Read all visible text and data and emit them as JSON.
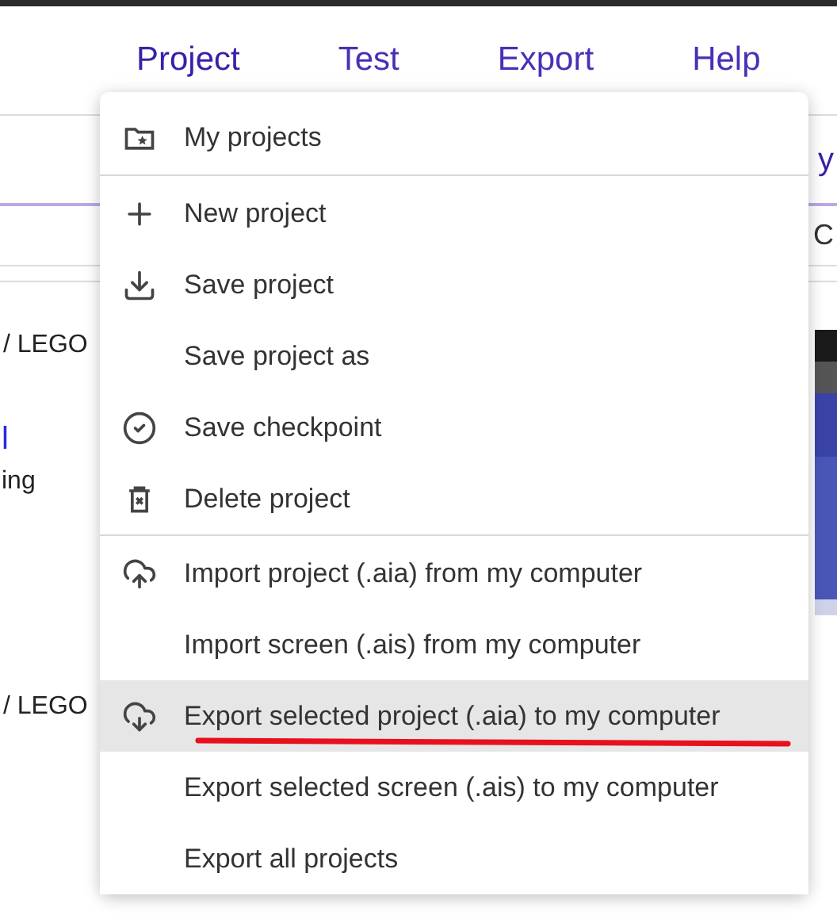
{
  "menubar": {
    "items": [
      {
        "label": "Project",
        "selected": true
      },
      {
        "label": "Test",
        "selected": false
      },
      {
        "label": "Export",
        "selected": false
      },
      {
        "label": "Help",
        "selected": false
      }
    ]
  },
  "background": {
    "texts": [
      "/ LEGO",
      "l",
      "ing",
      "/ LEGO"
    ],
    "right_texts": [
      "y",
      "C"
    ]
  },
  "menu": {
    "groups": [
      {
        "items": [
          {
            "label": "My projects",
            "selected": false,
            "underlined": false
          }
        ]
      },
      {
        "items": [
          {
            "label": "New project",
            "selected": false,
            "underlined": false
          },
          {
            "label": "Save project",
            "selected": false,
            "underlined": false
          },
          {
            "label": "Save project as",
            "selected": false,
            "underlined": false
          },
          {
            "label": "Save checkpoint",
            "selected": false,
            "underlined": false
          },
          {
            "label": "Delete project",
            "selected": false,
            "underlined": false
          }
        ]
      },
      {
        "items": [
          {
            "label": "Import project (.aia) from my computer",
            "selected": false,
            "underlined": false
          },
          {
            "label": "Import screen (.ais) from my computer",
            "selected": false,
            "underlined": false
          },
          {
            "label": "Export selected project (.aia) to my computer",
            "selected": true,
            "underlined": true
          },
          {
            "label": "Export selected screen (.ais) to my computer",
            "selected": false,
            "underlined": false
          },
          {
            "label": "Export all projects",
            "selected": false,
            "underlined": false
          }
        ]
      }
    ]
  }
}
